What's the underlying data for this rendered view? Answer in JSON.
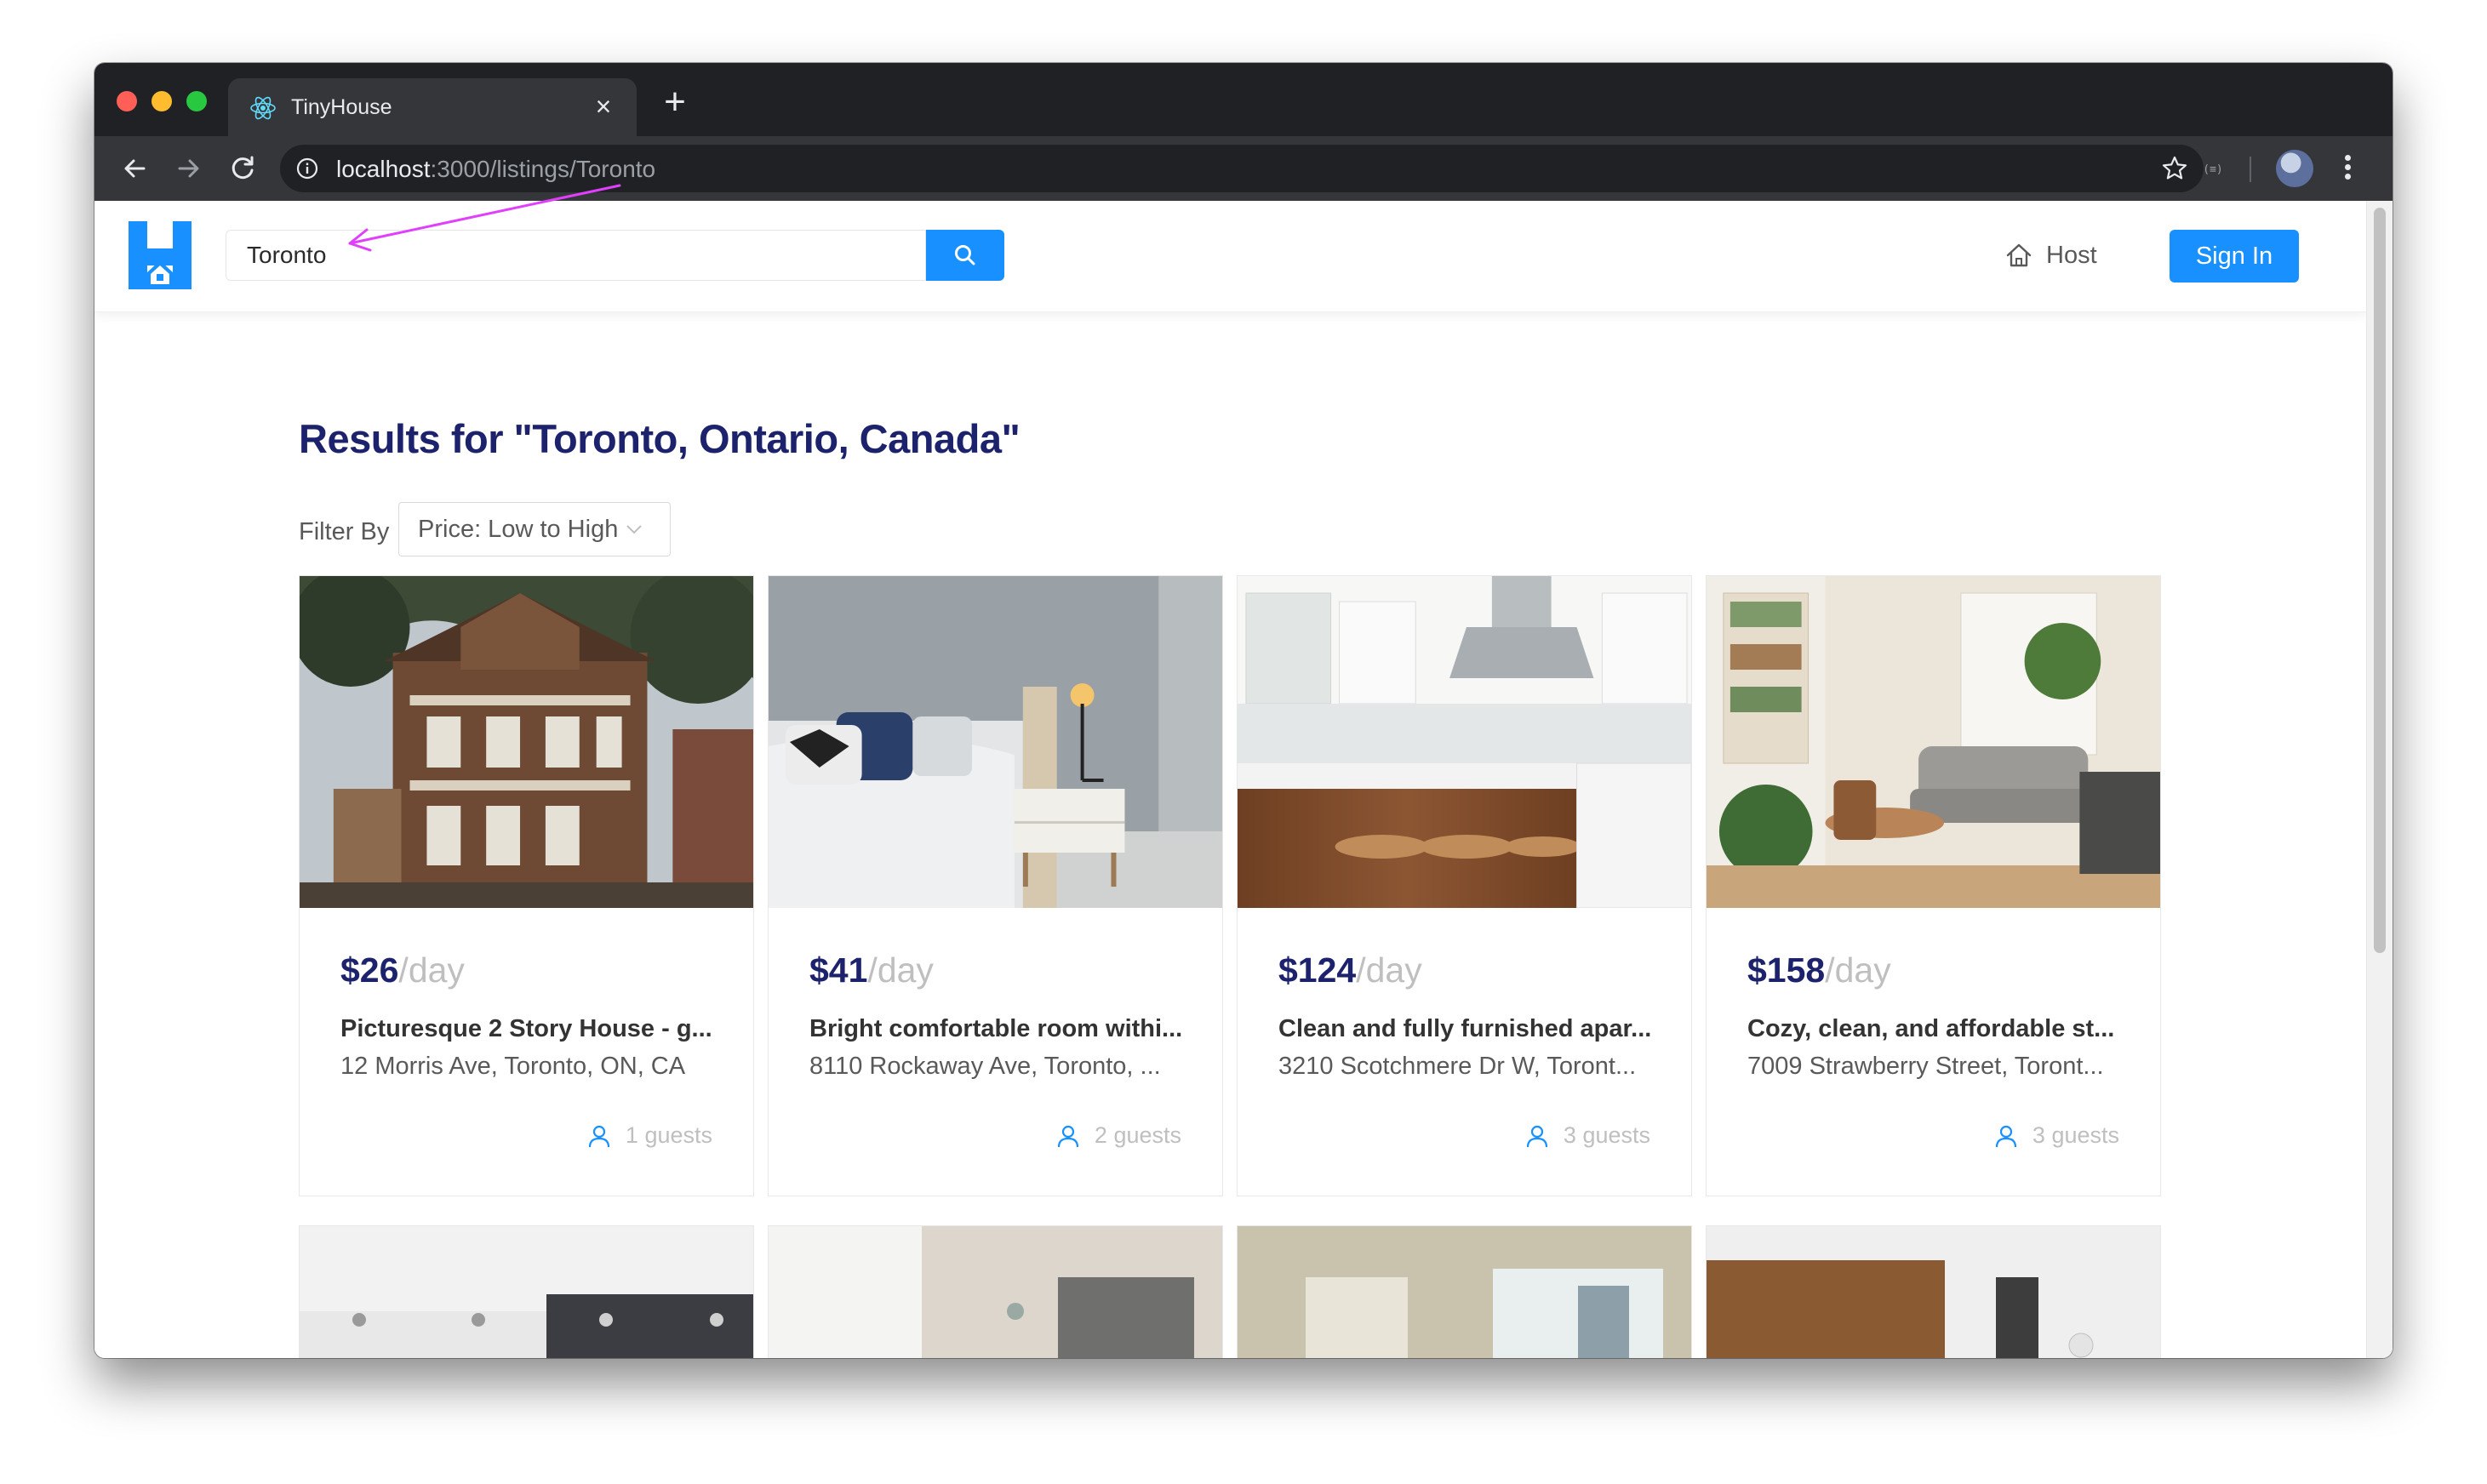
{
  "browser": {
    "tab_title": "TinyHouse",
    "new_tab_label": "+",
    "close_label": "×",
    "url_host": "localhost",
    "url_path": ":3000/listings/Toronto"
  },
  "header": {
    "search_value": "Toronto",
    "host_label": "Host",
    "signin_label": "Sign In"
  },
  "results": {
    "title": "Results for \"Toronto, Ontario, Canada\"",
    "filter_label": "Filter By",
    "filter_value": "Price: Low to High"
  },
  "listings": [
    {
      "price": "$26",
      "per": "/day",
      "title": "Picturesque 2 Story House - g...",
      "address": "12 Morris Ave, Toronto, ON, CA",
      "guests": "1 guests"
    },
    {
      "price": "$41",
      "per": "/day",
      "title": "Bright comfortable room withi...",
      "address": "8110 Rockaway Ave, Toronto, ...",
      "guests": "2 guests"
    },
    {
      "price": "$124",
      "per": "/day",
      "title": "Clean and fully furnished apar...",
      "address": "3210 Scotchmere Dr W, Toront...",
      "guests": "3 guests"
    },
    {
      "price": "$158",
      "per": "/day",
      "title": "Cozy, clean, and affordable st...",
      "address": "7009 Strawberry Street, Toront...",
      "guests": "3 guests"
    }
  ],
  "colors": {
    "primary": "#1890ff",
    "heading": "#1d226c",
    "annotation": "#e040fb"
  }
}
